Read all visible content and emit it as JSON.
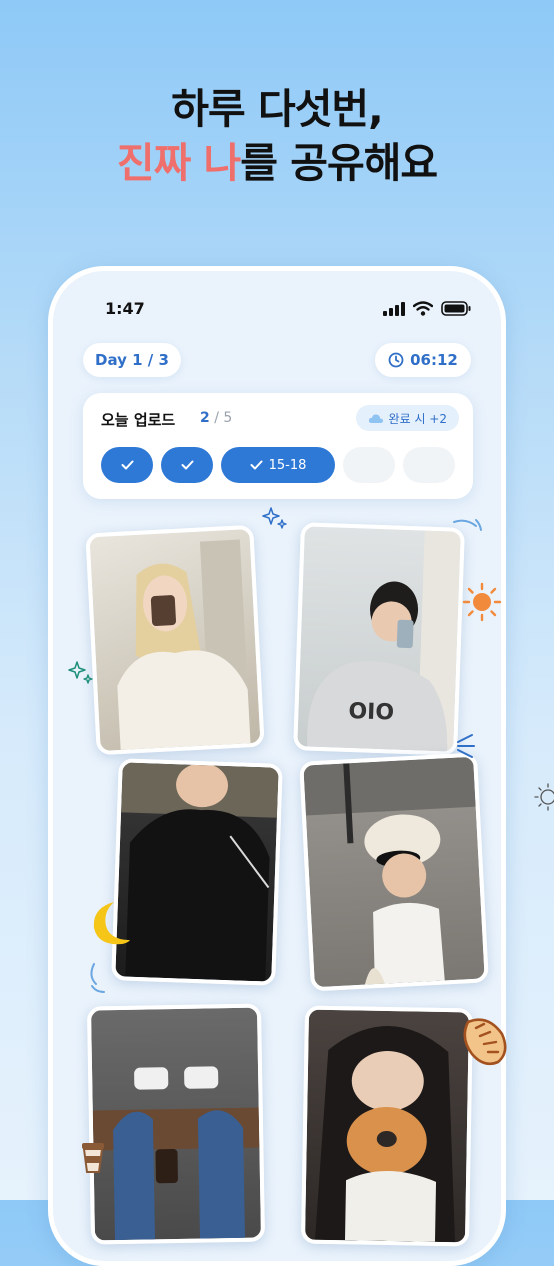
{
  "headline": {
    "line1": "하루 다섯번,",
    "line2_accent": "진짜 나",
    "line2_rest": "를 공유해요"
  },
  "status_bar": {
    "time": "1:47",
    "icons": [
      "signal-icon",
      "wifi-icon",
      "battery-icon"
    ]
  },
  "day_pill": {
    "label": "Day 1 / 3",
    "icon": "clock-icon"
  },
  "timer_pill": {
    "label": "06:12",
    "icon": "clock-icon"
  },
  "upload_card": {
    "title": "오늘 업로드",
    "count_done": "2",
    "count_total": "/ 5",
    "bonus": "완료 시 +2",
    "slots": [
      {
        "state": "done",
        "label": ""
      },
      {
        "state": "done",
        "label": ""
      },
      {
        "state": "done",
        "label": "15-18"
      },
      {
        "state": "empty",
        "label": ""
      },
      {
        "state": "empty",
        "label": ""
      }
    ]
  },
  "photos": [
    "photo-woman-drinking-coffee",
    "photo-man-mirror-selfie",
    "photo-man-black-jacket",
    "photo-woman-cap-sunglasses",
    "photo-sneakers-coffee",
    "photo-woman-bagel"
  ],
  "decorations": [
    "sparkle-icon",
    "sun-icon",
    "moon-icon",
    "bread-icon",
    "coffee-cup-icon"
  ],
  "colors": {
    "accent": "#ef6f6c",
    "primary": "#2f79d6",
    "moon": "#f5c518",
    "sun": "#f28a3c"
  }
}
